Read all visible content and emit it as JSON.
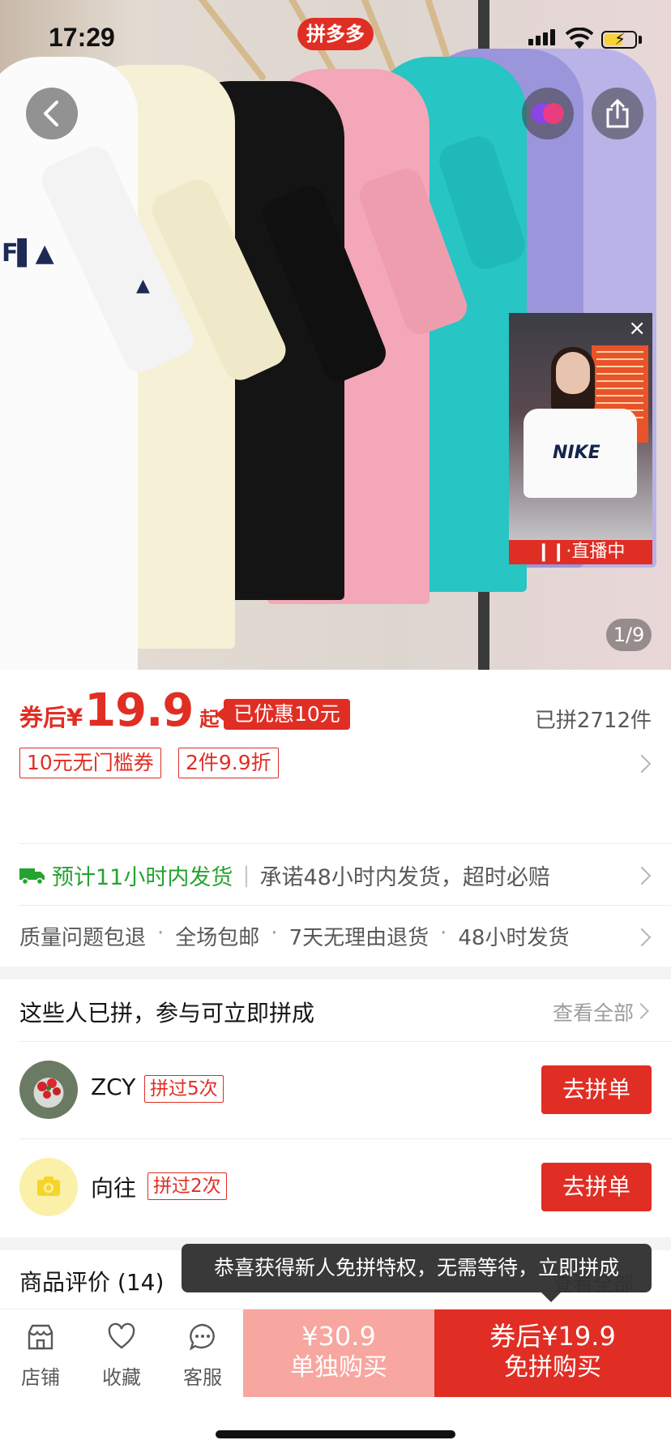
{
  "status_bar": {
    "time": "17:29",
    "app_badge": "拼多多"
  },
  "hero": {
    "pager": "1/9",
    "live_label": "直播中",
    "live_close": "×"
  },
  "price": {
    "prefix": "券后¥",
    "amount": "19.9",
    "suffix": "起",
    "discount_badge": "已优惠10元",
    "sold": "已拼2712件",
    "coupons": [
      "10元无门槛券",
      "2件9.9折"
    ]
  },
  "shipping": {
    "estimate": "预计11小时内发货",
    "promise": "承诺48小时内发货，超时必赔"
  },
  "services": [
    "质量问题包退",
    "全场包邮",
    "7天无理由退货",
    "48小时发货"
  ],
  "group_buy": {
    "title": "这些人已拼，参与可立即拼成",
    "view_all": "查看全部",
    "members": [
      {
        "name": "ZCY",
        "badge": "拼过5次",
        "action": "去拼单"
      },
      {
        "name": "向往",
        "badge": "拼过2次",
        "action": "去拼单"
      }
    ]
  },
  "reviews": {
    "title": "商品评价 (14)",
    "view_all": "查看全部"
  },
  "toast": "恭喜获得新人免拼特权，无需等待，立即拼成",
  "bottom_bar": {
    "tabs": [
      {
        "label": "店铺",
        "icon": "store-icon"
      },
      {
        "label": "收藏",
        "icon": "heart-icon"
      },
      {
        "label": "客服",
        "icon": "chat-icon"
      }
    ],
    "solo": {
      "price": "¥30.9",
      "label": "单独购买"
    },
    "group": {
      "price": "券后¥19.9",
      "label": "免拼购买"
    }
  },
  "colors": {
    "brand_red": "#e02e24",
    "green": "#25a330",
    "muted": "#9c9c9c"
  }
}
